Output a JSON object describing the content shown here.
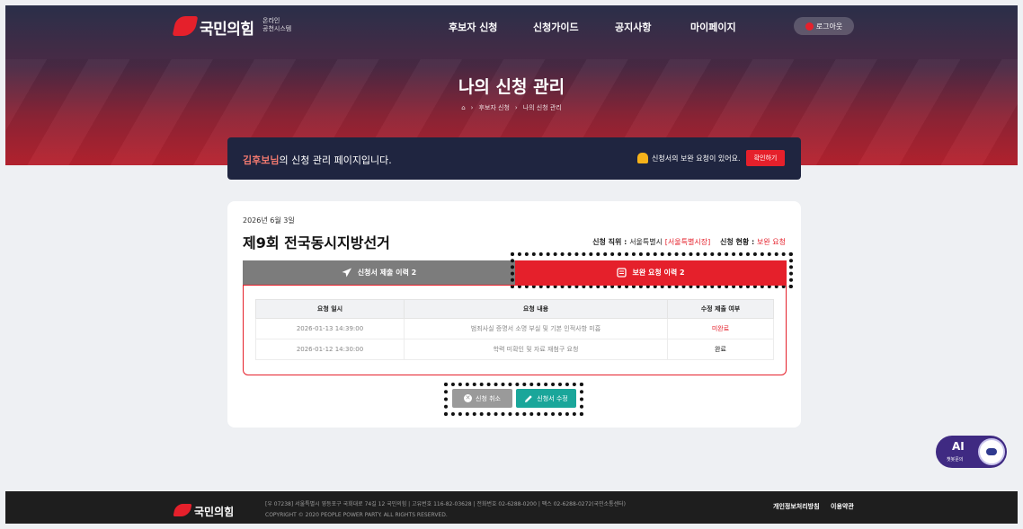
{
  "nav": {
    "logo_text": "국민의힘",
    "logo_sub_line1": "온라인",
    "logo_sub_line2": "공천시스템",
    "items": [
      {
        "label": "후보자 신청"
      },
      {
        "label": "신청가이드"
      },
      {
        "label": "공지사항"
      },
      {
        "label": "마이페이지"
      }
    ],
    "login_label": "로그아웃"
  },
  "hero": {
    "title": "나의 신청 관리",
    "breadcrumb": [
      "후보자 신청",
      "나의 신청 관리"
    ]
  },
  "welcome": {
    "name": "김후보님",
    "text": "의 신청 관리 페이지입니다.",
    "notice": "신청서의 보완 요청이 있어요.",
    "check_button": "확인하기"
  },
  "application": {
    "date": "2026년 6월 3일",
    "title": "제9회 전국동시지방선거",
    "position_label": "신청 직위 :",
    "position_value": "서울특별시",
    "position_detail": "[서울특별시장]",
    "status_label": "신청 현황 :",
    "status_value": "보완 요청"
  },
  "tabs": [
    {
      "label": "신청서 제출 이력 2",
      "icon": "send-icon"
    },
    {
      "label": "보완 요청 이력 2",
      "icon": "document-icon",
      "active": true
    }
  ],
  "table": {
    "headers": [
      "요청 일시",
      "요청 내용",
      "수정 제출 여부"
    ],
    "rows": [
      {
        "datetime": "2026-01-13 14:39:00",
        "content": "범죄사실 증명서 소명 부실 및 기본 인적사항 미흡",
        "status": "미완료"
      },
      {
        "datetime": "2026-01-12 14:30:00",
        "content": "학력 미확인 및 자료 재첨구 요청",
        "status": "완료"
      }
    ]
  },
  "actions": {
    "cancel_label": "신청 취소",
    "edit_label": "신청서 수정"
  },
  "footer": {
    "logo_text": "국민의힘",
    "address": "[우 07238] 서울특별시 영등포구 국회대로 74길 12 국민의힘  |  고유번호 116-82-03628  |  전화번호 02-6288-0200  |  팩스 02-6288-0272(국민소통센터)",
    "copyright": "COPYRIGHT © 2020 PEOPLE POWER PARTY. ALL RIGHTS RESERVED.",
    "privacy_link": "개인정보처리방침",
    "terms_link": "이용약관"
  },
  "chatbot": {
    "title": "AI",
    "label": "챗봇문의"
  },
  "colors": {
    "brand_red": "#e5202b",
    "navy": "#1f2540",
    "teal": "#1aa69a",
    "gray_tab": "#7c7c7c",
    "chatbot_purple": "#3f2a82"
  }
}
